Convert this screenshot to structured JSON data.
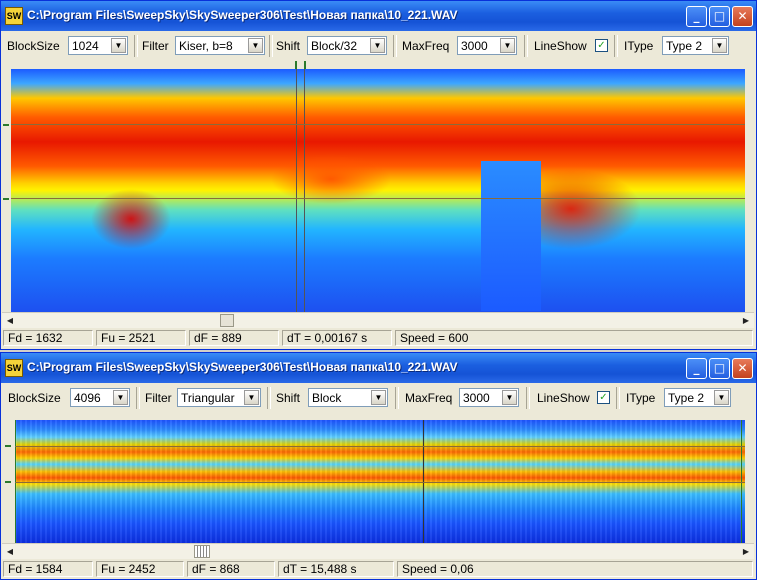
{
  "app_icon_text": "SW",
  "windows": [
    {
      "title": "C:\\Program Files\\SweepSky\\SkySweeper306\\Test\\Новая папка\\10_221.WAV",
      "toolbar": {
        "blocksize_label": "BlockSize",
        "blocksize_value": "1024",
        "filter_label": "Filter",
        "filter_value": "Kiser, b=8",
        "shift_label": "Shift",
        "shift_value": "Block/32",
        "maxfreq_label": "MaxFreq",
        "maxfreq_value": "3000",
        "lineshow_label": "LineShow",
        "lineshow_checked": true,
        "itype_label": "IType",
        "itype_value": "Type 2"
      },
      "status": {
        "fd": "Fd = 1632",
        "fu": "Fu = 2521",
        "df": "dF = 889",
        "dt": "dT = 0,00167 s",
        "speed": "Speed = 600"
      }
    },
    {
      "title": "C:\\Program Files\\SweepSky\\SkySweeper306\\Test\\Новая папка\\10_221.WAV",
      "toolbar": {
        "blocksize_label": "BlockSize",
        "blocksize_value": "4096",
        "filter_label": "Filter",
        "filter_value": "Triangular",
        "shift_label": "Shift",
        "shift_value": "Block",
        "maxfreq_label": "MaxFreq",
        "maxfreq_value": "3000",
        "lineshow_label": "LineShow",
        "lineshow_checked": true,
        "itype_label": "IType",
        "itype_value": "Type 2"
      },
      "status": {
        "fd": "Fd = 1584",
        "fu": "Fu = 2452",
        "df": "dF = 868",
        "dt": "dT = 15,488 s",
        "speed": "Speed = 0,06"
      }
    }
  ],
  "icons": {
    "minimize": "minimize-icon",
    "maximize": "maximize-icon",
    "close": "close-icon",
    "dropdown": "chevron-down-icon",
    "scroll_left": "arrow-left-icon",
    "scroll_right": "arrow-right-icon"
  },
  "colors": {
    "titlebar": "#1b5fe0",
    "window_bg": "#ece9d8",
    "close_button": "#c3411e",
    "cursor_line": "#8a6b3a"
  }
}
